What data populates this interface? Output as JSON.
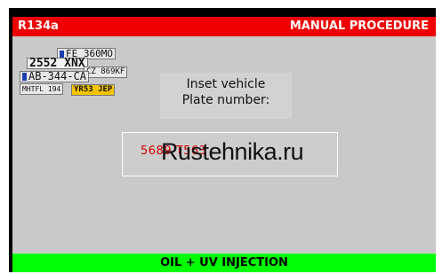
{
  "header": {
    "left_label": "R134a",
    "right_label": "MANUAL PROCEDURE"
  },
  "plates": [
    "FE 360MO",
    "2552 XNX",
    "CZ 869KF",
    "AB-344-CA",
    "MHTFL 194",
    "YR53 JEP"
  ],
  "prompt": {
    "line1": "Inset vehicle",
    "line2": "Plate number:"
  },
  "input": {
    "value": "5689 T563"
  },
  "watermark": "Rustehnika.ru",
  "footer": {
    "label": "OIL + UV INJECTION"
  },
  "colors": {
    "header": "#f00000",
    "footer": "#00ff00",
    "panel": "#c9c9c9",
    "input_text": "#d40000"
  }
}
